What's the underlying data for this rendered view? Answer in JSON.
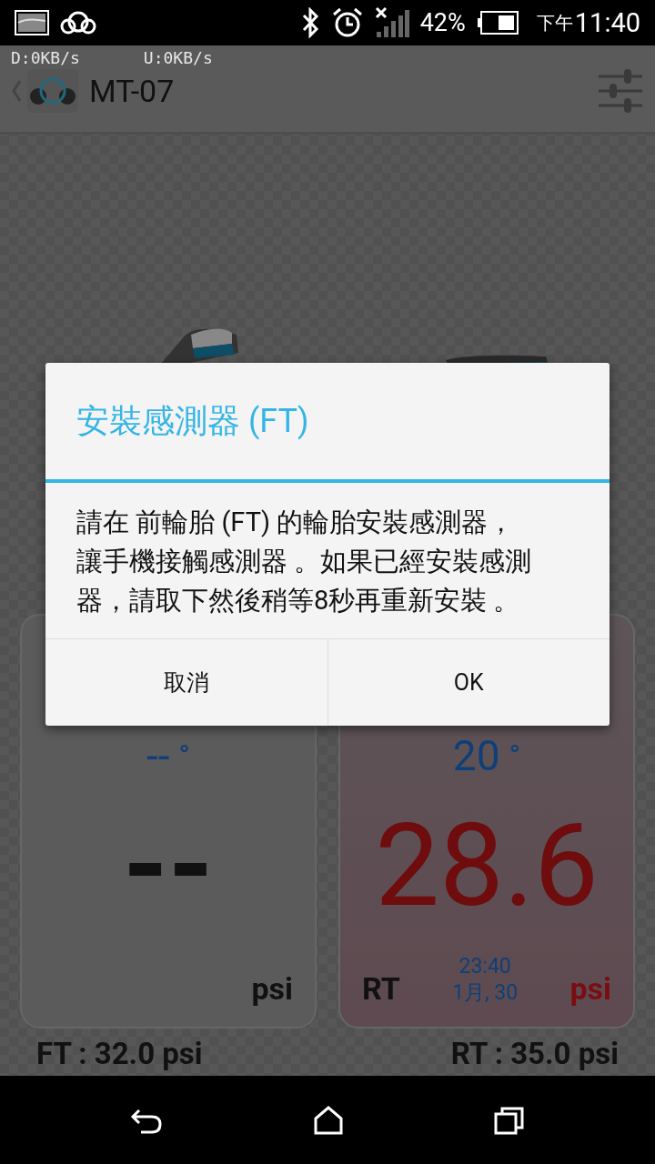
{
  "status_bar": {
    "battery": "42%",
    "time_prefix": "下午",
    "time": "11:40"
  },
  "app_bar": {
    "download": "D:0KB/s",
    "upload": "U:0KB/s",
    "title": "MT-07"
  },
  "tires": [
    {
      "temperature": "--",
      "temp_unit": "°",
      "pressure": "--",
      "unit": "psi",
      "alert": false
    },
    {
      "label": "RT",
      "temperature": "20",
      "temp_unit": "°",
      "pressure": "28.6",
      "unit": "psi",
      "time": "23:40",
      "date": "1月, 30",
      "alert": true
    }
  ],
  "summary": [
    "FT : 32.0 psi",
    "RT : 35.0 psi"
  ],
  "dialog": {
    "title": "安裝感測器 (FT)",
    "message": "請在 前輪胎 (FT) 的輪胎安裝感測器，讓手機接觸感測器 。如果已經安裝感測器，請取下然後稍等8秒再重新安裝 。",
    "buttons": [
      "取消",
      "OK"
    ]
  }
}
